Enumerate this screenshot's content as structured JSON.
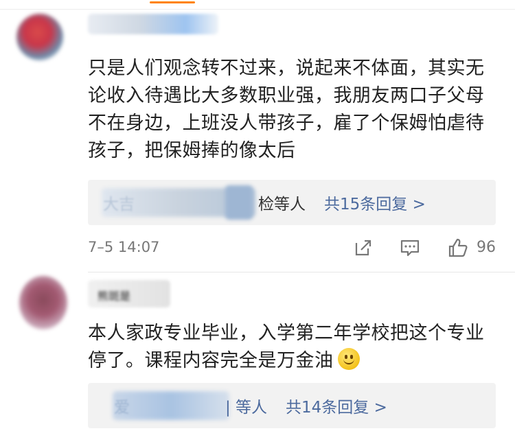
{
  "comments": [
    {
      "body": "只是人们观念转不过来，说起来不体面，其实无论收入待遇比大多数职业强，我朋友两口子父母不在身边，上班没人带孩子，雇了个保姆怕虐待孩子，把保姆捧的像太后",
      "reply_summary": {
        "blurred_prefix": "大吉",
        "names_suffix": "检等人",
        "count_link": "共15条回复 >"
      },
      "timestamp": "7–5 14:07",
      "likes": "96"
    },
    {
      "username_fragment": "熊斑是",
      "body": "本人家政专业毕业，入学第二年学校把这个专业停了。课程内容完全是万金油",
      "reply_summary": {
        "blurred_prefix": "爱",
        "names_suffix": "| 等人",
        "count_link": "共14条回复 >"
      }
    }
  ],
  "icons": {
    "share": "share-icon",
    "comment": "comment-icon",
    "like": "thumbs-up-icon",
    "emoji": "smiley-emoji"
  },
  "colors": {
    "accent": "#ff8200",
    "link": "#4c6a9e",
    "reply_bg": "#f2f2f2",
    "meta": "#777777"
  }
}
